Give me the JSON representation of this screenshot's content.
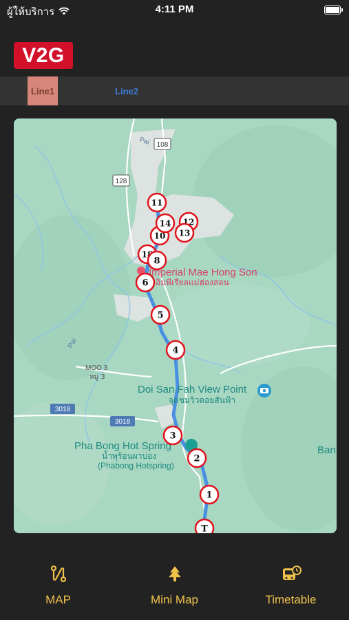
{
  "status": {
    "carrier": "ผู้ให้บริการ",
    "time": "4:11 PM"
  },
  "app": {
    "logo": "V2G"
  },
  "tabs": [
    {
      "label": "Line1",
      "selected": true
    },
    {
      "label": "Line2",
      "selected": false
    }
  ],
  "map": {
    "labels": {
      "place_imperial": "Imperial Mae Hong Son",
      "place_imperial_th": "อิมพีเรียลแม่ฮ่องสอน",
      "place_doi": "Doi San Fah View Point",
      "place_doi_th": "จุดชมวิวดอยสันฟ้า",
      "place_hotspring": "Pha Bong Hot Spring",
      "place_hotspring_th": "น้ำพุร้อนผาบ่อง",
      "place_hotspring_en": "(Phabong Hotspring)",
      "place_ban": "Ban",
      "moo3": "MOO 3",
      "moo3_th": "หมู่ 3",
      "road_pai_top": "Pai",
      "road_pai_left": "Pai",
      "shield_108": "108",
      "shield_128": "128",
      "shield_3018_a": "3018",
      "shield_3018_b": "3018"
    },
    "stops": [
      "T",
      "1",
      "2",
      "3",
      "4",
      "5",
      "6",
      "8",
      "18",
      "11",
      "12",
      "13",
      "14",
      "10"
    ]
  },
  "nav": {
    "items": [
      {
        "label": "MAP",
        "icon": "route-icon"
      },
      {
        "label": "Mini Map",
        "icon": "tree-icon"
      },
      {
        "label": "Timetable",
        "icon": "bus-clock-icon"
      }
    ]
  },
  "colors": {
    "accent": "#f0c24b",
    "logo_bg": "#d2102a",
    "tab_selected_bg": "#d6867a",
    "tab_link": "#3d7ad8",
    "route": "#4a90e2",
    "stop_border": "#e0141e"
  }
}
